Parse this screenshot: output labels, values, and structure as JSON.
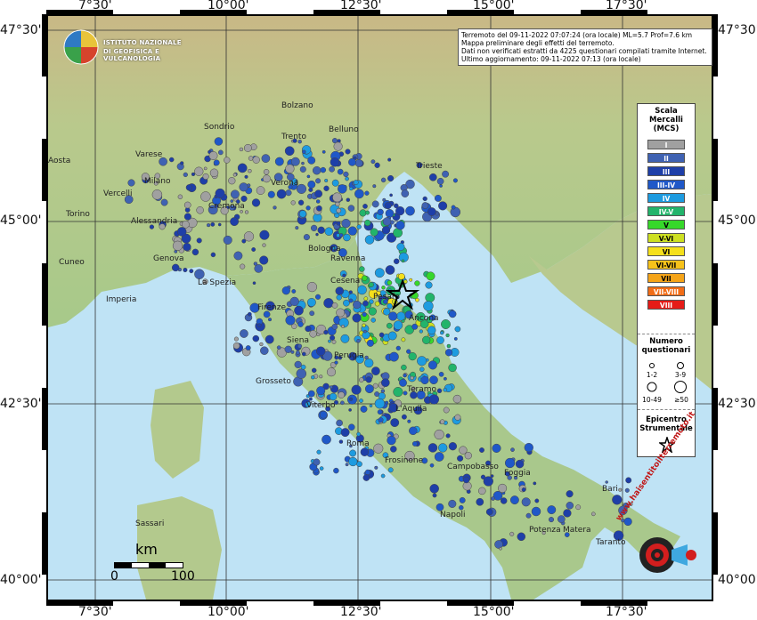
{
  "info": {
    "line1": "Terremoto del 09-11-2022 07:07:24 (ora locale) ML=5.7 Prof=7.6 km",
    "line2": "Mappa preliminare degli effetti del terremoto.",
    "line3": "Dati non verificati estratti da 4225 questionari compilati tramite Internet.",
    "line4": "Ultimo aggiornamento: 09-11-2022 07:13 (ora locale)"
  },
  "logo": {
    "line1": "ISTITUTO NAZIONALE",
    "line2": "DI GEOFISICA E VULCANOLOGIA"
  },
  "axes": {
    "top": [
      "7°30'",
      "10°00'",
      "12°30'",
      "15°00'",
      "17°30'"
    ],
    "bottom": [
      "7°30'",
      "10°00'",
      "12°30'",
      "15°00'",
      "17°30'"
    ],
    "left": [
      "47°30'",
      "45°00'",
      "42°30'",
      "40°00'"
    ],
    "right": [
      "47°30'",
      "45°00'",
      "42°30'",
      "40°00'"
    ]
  },
  "legend": {
    "scale_title": [
      "Scala",
      "Mercalli",
      "(MCS)"
    ],
    "classes": [
      {
        "label": "I",
        "color": "#a0a0a0"
      },
      {
        "label": "II",
        "color": "#3f62b2"
      },
      {
        "label": "III",
        "color": "#1e3fa8"
      },
      {
        "label": "III-IV",
        "color": "#1f58c8"
      },
      {
        "label": "IV",
        "color": "#1d9be0"
      },
      {
        "label": "IV-V",
        "color": "#22b46b"
      },
      {
        "label": "V",
        "color": "#36d82a"
      },
      {
        "label": "V-VI",
        "color": "#cde022"
      },
      {
        "label": "VI",
        "color": "#f5e01b"
      },
      {
        "label": "VI-VII",
        "color": "#f7c21a"
      },
      {
        "label": "VII",
        "color": "#f5a418"
      },
      {
        "label": "VII-VIII",
        "color": "#f26d17"
      },
      {
        "label": "VIII",
        "color": "#e51b17"
      }
    ],
    "count_title": [
      "Numero",
      "questionari"
    ],
    "counts": [
      "1-2",
      "3-9",
      "10-49",
      "≥50"
    ],
    "epicentre_title": [
      "Epicentro",
      "Strumentale"
    ]
  },
  "scalebar": {
    "unit": "km",
    "min": "0",
    "max": "100"
  },
  "cities": [
    {
      "name": "Bolzano"
    },
    {
      "name": "Sondrio"
    },
    {
      "name": "Trento"
    },
    {
      "name": "Belluno"
    },
    {
      "name": "Aosta"
    },
    {
      "name": "Varese"
    },
    {
      "name": "Milano"
    },
    {
      "name": "Trieste"
    },
    {
      "name": "Vercelli"
    },
    {
      "name": "Cremona"
    },
    {
      "name": "Verona"
    },
    {
      "name": "Torino"
    },
    {
      "name": "Alessandria"
    },
    {
      "name": "Cuneo"
    },
    {
      "name": "Genova"
    },
    {
      "name": "Bologna"
    },
    {
      "name": "Ravenna"
    },
    {
      "name": "Cesena"
    },
    {
      "name": "Imperia"
    },
    {
      "name": "La Spezia"
    },
    {
      "name": "Pesaro"
    },
    {
      "name": "Ancona"
    },
    {
      "name": "Firenze"
    },
    {
      "name": "Siena"
    },
    {
      "name": "Perugia"
    },
    {
      "name": "Grosseto"
    },
    {
      "name": "Teramo"
    },
    {
      "name": "L'Aquila"
    },
    {
      "name": "Viterbo"
    },
    {
      "name": "Roma"
    },
    {
      "name": "Frosinone"
    },
    {
      "name": "Campobasso"
    },
    {
      "name": "Foggia"
    },
    {
      "name": "Bari"
    },
    {
      "name": "Napoli"
    },
    {
      "name": "Potenza"
    },
    {
      "name": "Matera"
    },
    {
      "name": "Taranto"
    },
    {
      "name": "Sassari"
    }
  ],
  "brand": {
    "text": "www.haisentitoilterremoto.it"
  }
}
